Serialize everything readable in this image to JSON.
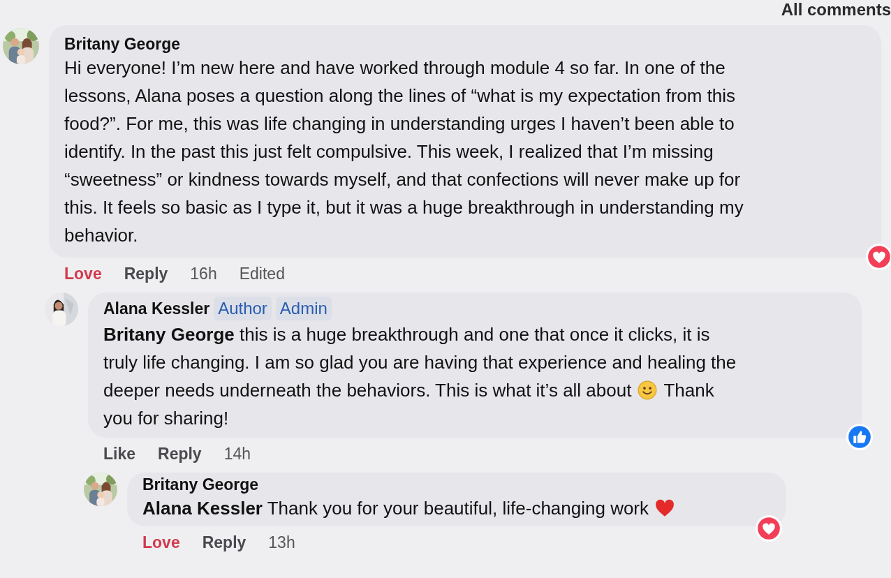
{
  "header": {
    "sort_label": "All comments"
  },
  "comments": [
    {
      "author": "Britany George",
      "avatar": {
        "kind": "picture"
      },
      "reaction_badge": {
        "kind": "love"
      },
      "lines": [
        {
          "parts": [
            {
              "kind": "text",
              "text": "Hi everyone! I’m new here and have worked through module 4 so far. In one of the"
            }
          ]
        },
        {
          "parts": [
            {
              "kind": "text",
              "text": "lessons, Alana poses a question along the lines of “what is my expectation from this"
            }
          ]
        },
        {
          "parts": [
            {
              "kind": "text",
              "text": "food?”. For me, this was life changing in understanding urges I haven’t been able to"
            }
          ]
        },
        {
          "parts": [
            {
              "kind": "text",
              "text": "identify. In the past this just felt compulsive. This week, I realized that I’m missing"
            }
          ]
        },
        {
          "parts": [
            {
              "kind": "text",
              "text": "“sweetness” or kindness towards myself, and that confections will never make up for"
            }
          ]
        },
        {
          "parts": [
            {
              "kind": "text",
              "text": "this. It feels so basic as I type it, but it was a huge breakthrough in understanding my"
            }
          ]
        },
        {
          "parts": [
            {
              "kind": "text",
              "text": "behavior."
            }
          ]
        }
      ],
      "actions": [
        {
          "kind": "love",
          "label": "Love"
        },
        {
          "kind": "reply",
          "label": "Reply"
        },
        {
          "kind": "meta",
          "label": "16h"
        },
        {
          "kind": "meta",
          "label": "Edited"
        }
      ],
      "children": [
        {
          "author": "Alana Kessler",
          "badges": [
            "Author",
            "Admin"
          ],
          "avatar": {
            "kind": "picture"
          },
          "reaction_badge": {
            "kind": "like"
          },
          "lines": [
            {
              "parts": [
                {
                  "kind": "text",
                  "text": "**Britany George** this is a huge breakthrough and one that once it clicks, it is"
                }
              ]
            },
            {
              "parts": [
                {
                  "kind": "text",
                  "text": "truly life changing. I am so glad you are having that experience and healing the"
                }
              ]
            },
            {
              "parts": [
                {
                  "kind": "text",
                  "text": "deeper needs underneath the behaviors. This is what it’s all about"
                },
                {
                  "kind": "smiley"
                },
                {
                  "kind": "text",
                  "text": "Thank"
                }
              ]
            },
            {
              "parts": [
                {
                  "kind": "text",
                  "text": "you for sharing!"
                }
              ]
            }
          ],
          "actions": [
            {
              "kind": "like",
              "label": "Like"
            },
            {
              "kind": "reply",
              "label": "Reply"
            },
            {
              "kind": "meta",
              "label": "14h"
            }
          ],
          "children": [
            {
              "author": "Britany George",
              "avatar": {
                "kind": "picture"
              },
              "reaction_badge": {
                "kind": "love"
              },
              "lines": [
                {
                  "parts": [
                    {
                      "kind": "text",
                      "text": "**Alana Kessler** Thank you for your beautiful, life-changing work"
                    },
                    {
                      "kind": "heart"
                    }
                  ]
                }
              ],
              "actions": [
                {
                  "kind": "love",
                  "label": "Love"
                },
                {
                  "kind": "reply",
                  "label": "Reply"
                },
                {
                  "kind": "meta",
                  "label": "13h"
                }
              ]
            }
          ]
        }
      ]
    }
  ]
}
